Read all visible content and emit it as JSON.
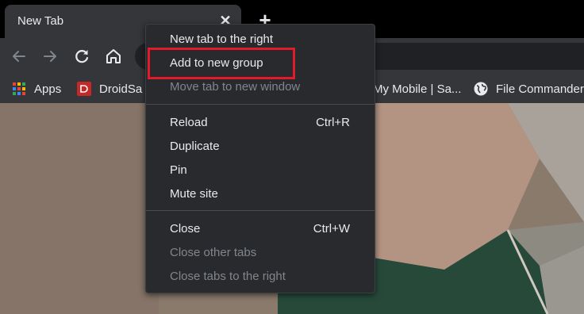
{
  "tab": {
    "title": "New Tab",
    "close_icon": "close-icon"
  },
  "toolbar": {
    "back_icon": "arrow-left-icon",
    "forward_icon": "arrow-right-icon",
    "reload_icon": "reload-icon",
    "home_icon": "home-icon"
  },
  "bookmarks": [
    {
      "label": "Apps",
      "icon": "apps-grid-icon"
    },
    {
      "label": "DroidSa",
      "icon": "droidsans-icon"
    },
    {
      "label": "My Mobile | Sa...",
      "icon": ""
    },
    {
      "label": "File Commander",
      "icon": "globe-icon"
    }
  ],
  "context_menu": {
    "items": [
      {
        "label": "New tab to the right",
        "shortcut": "",
        "enabled": true
      },
      {
        "label": "Add to new group",
        "shortcut": "",
        "enabled": true,
        "highlighted": true
      },
      {
        "label": "Move tab to new window",
        "shortcut": "",
        "enabled": false
      },
      {
        "label": "Reload",
        "shortcut": "Ctrl+R",
        "enabled": true
      },
      {
        "label": "Duplicate",
        "shortcut": "",
        "enabled": true
      },
      {
        "label": "Pin",
        "shortcut": "",
        "enabled": true
      },
      {
        "label": "Mute site",
        "shortcut": "",
        "enabled": true
      },
      {
        "label": "Close",
        "shortcut": "Ctrl+W",
        "enabled": true
      },
      {
        "label": "Close other tabs",
        "shortcut": "",
        "enabled": false
      },
      {
        "label": "Close tabs to the right",
        "shortcut": "",
        "enabled": false
      }
    ]
  },
  "colors": {
    "highlight_border": "#e21b2a",
    "menu_bg": "#292a2d",
    "toolbar_bg": "#35363a"
  }
}
